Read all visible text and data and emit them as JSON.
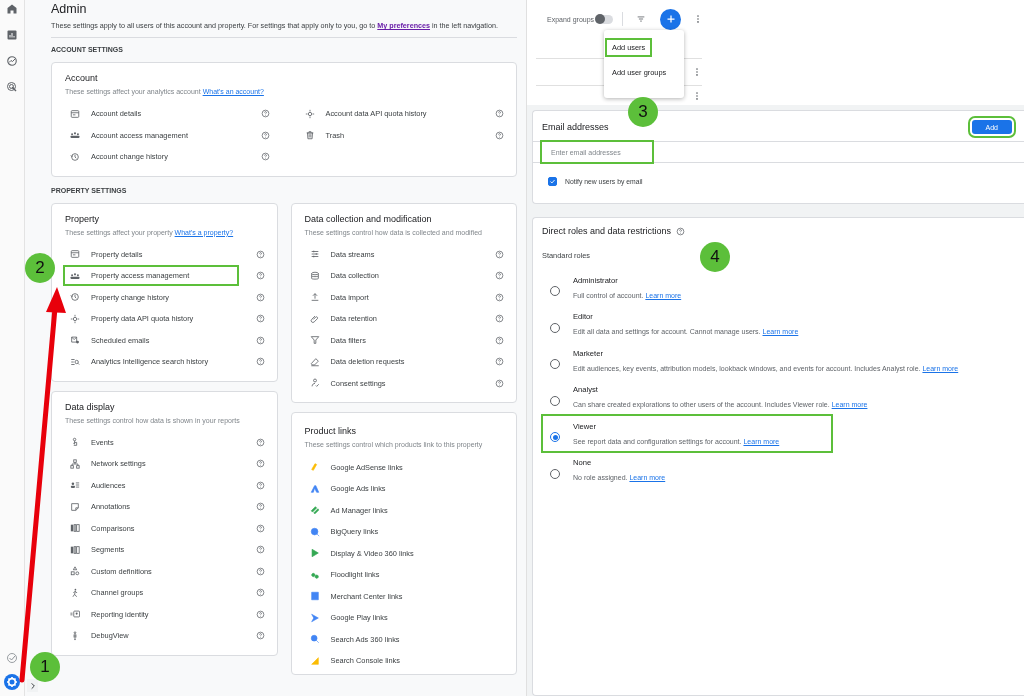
{
  "admin": {
    "title": "Admin",
    "intro": "These settings apply to all users of this account and property. For settings that apply only to you, go to",
    "intro_link": "My preferences",
    "intro_end": "in the left navigation.",
    "account_heading": "ACCOUNT SETTINGS",
    "account_card": {
      "title": "Account",
      "description": "These settings affect your analytics account",
      "link": "What's an account?",
      "items": [
        {
          "label": "Account details",
          "highlighted": false
        },
        {
          "label": "Account access management",
          "highlighted": false
        },
        {
          "label": "Account change history",
          "highlighted": false
        },
        {
          "label": "Account data API quota history",
          "highlighted": false
        },
        {
          "label": "Trash",
          "highlighted": false
        }
      ]
    },
    "property_heading": "PROPERTY SETTINGS",
    "property_cards": [
      {
        "kind": "settings",
        "title": "Property",
        "description": "These settings affect your property",
        "link": "What's a property?",
        "items": [
          {
            "label": "Property details",
            "highlighted": false
          },
          {
            "label": "Property access management",
            "highlighted": true
          },
          {
            "label": "Property change history",
            "highlighted": false
          },
          {
            "label": "Property data API quota history",
            "highlighted": false
          },
          {
            "label": "Scheduled emails",
            "highlighted": false
          },
          {
            "label": "Analytics Intelligence search history",
            "highlighted": false
          }
        ]
      },
      {
        "kind": "settings",
        "title": "Data collection and modification",
        "description": "These settings control how data is collected and modified",
        "items": [
          {
            "label": "Data streams",
            "highlighted": false
          },
          {
            "label": "Data collection",
            "highlighted": false
          },
          {
            "label": "Data import",
            "highlighted": false
          },
          {
            "label": "Data retention",
            "highlighted": false
          },
          {
            "label": "Data filters",
            "highlighted": false
          },
          {
            "label": "Data deletion requests",
            "highlighted": false
          },
          {
            "label": "Consent settings",
            "highlighted": false
          }
        ]
      },
      {
        "kind": "settings",
        "title": "Data display",
        "description": "These settings control how data is shown in your reports",
        "items": [
          {
            "label": "Events",
            "highlighted": false
          },
          {
            "label": "Network settings",
            "highlighted": false
          },
          {
            "label": "Audiences",
            "highlighted": false
          },
          {
            "label": "Annotations",
            "highlighted": false
          },
          {
            "label": "Comparisons",
            "highlighted": false
          },
          {
            "label": "Segments",
            "highlighted": false
          },
          {
            "label": "Custom definitions",
            "highlighted": false
          },
          {
            "label": "Channel groups",
            "highlighted": false
          },
          {
            "label": "Reporting identity",
            "highlighted": false
          },
          {
            "label": "DebugView",
            "highlighted": false
          }
        ]
      },
      {
        "kind": "links",
        "title": "Product links",
        "description": "These settings control which products link to this property",
        "items": [
          {
            "label": "Google AdSense links",
            "highlighted": false
          },
          {
            "label": "Google Ads links",
            "highlighted": false
          },
          {
            "label": "Ad Manager links",
            "highlighted": false
          },
          {
            "label": "BigQuery links",
            "highlighted": false
          },
          {
            "label": "Display & Video 360 links",
            "highlighted": false
          },
          {
            "label": "Floodlight links",
            "highlighted": false
          },
          {
            "label": "Merchant Center links",
            "highlighted": false
          },
          {
            "label": "Google Play links",
            "highlighted": false
          },
          {
            "label": "Search Ads 360 links",
            "highlighted": false
          },
          {
            "label": "Search Console links",
            "highlighted": false
          }
        ]
      }
    ]
  },
  "users_panel": {
    "toggle_label": "Expand groups",
    "toggle_on": false,
    "menu": [
      {
        "label": "Add users",
        "highlighted": true
      },
      {
        "label": "Add user groups",
        "highlighted": false
      }
    ]
  },
  "email_section": {
    "title": "Email addresses",
    "placeholder": "Enter email addresses",
    "input_highlighted": true,
    "add_button": "Add",
    "add_highlighted": true,
    "notify_label": "Notify new users by email",
    "notify_checked": true
  },
  "roles_section": {
    "title": "Direct roles and data restrictions",
    "subtitle": "Standard roles",
    "roles": [
      {
        "name": "Administrator",
        "description": "Full control of account.",
        "link": "Learn more",
        "selected": false,
        "highlighted": false
      },
      {
        "name": "Editor",
        "description": "Edit all data and settings for account. Cannot manage users.",
        "link": "Learn more",
        "selected": false,
        "highlighted": false
      },
      {
        "name": "Marketer",
        "description": "Edit audiences, key events, attribution models, lookback windows, and events for account. Includes Analyst role.",
        "link": "Learn more",
        "selected": false,
        "highlighted": false
      },
      {
        "name": "Analyst",
        "description": "Can share created explorations to other users of the account. Includes Viewer role.",
        "link": "Learn more",
        "selected": false,
        "highlighted": false
      },
      {
        "name": "Viewer",
        "description": "See report data and configuration settings for account.",
        "link": "Learn more",
        "selected": true,
        "highlighted": true
      },
      {
        "name": "None",
        "description": "No role assigned.",
        "link": "Learn more",
        "selected": false,
        "highlighted": false
      }
    ]
  },
  "steps": [
    {
      "number": "1"
    },
    {
      "number": "2"
    },
    {
      "number": "3"
    },
    {
      "number": "4"
    }
  ]
}
